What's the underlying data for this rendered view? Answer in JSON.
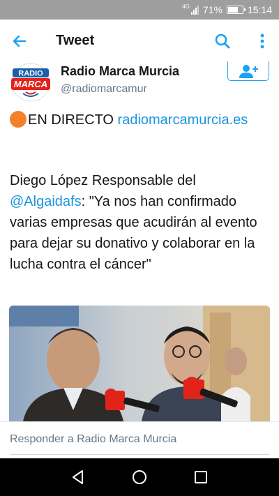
{
  "status_bar": {
    "network": "4G",
    "battery": "71%",
    "battery_level": 0.71,
    "time": "15:14"
  },
  "app_bar": {
    "title": "Tweet",
    "icons": [
      "back-arrow-icon",
      "search-icon",
      "more-vert-icon"
    ]
  },
  "tweet": {
    "author_name": "Radio Marca Murcia",
    "author_handle": "@radiomarcamur",
    "avatar_text": {
      "top": "RADIO",
      "bottom": "MARCA"
    },
    "live_prefix": "EN DIRECTO",
    "live_link": "radiomarcamurcia.es",
    "body_before_mention": "Diego López Responsable del",
    "mention": "@Algaidafs",
    "body_after_mention": ": \"Ya nos han confirmado varias empresas que acudirán al evento para dejar su donativo y colaborar en la lucha contra el cáncer\""
  },
  "reply": {
    "placeholder": "Responder a Radio Marca Murcia"
  },
  "colors": {
    "accent": "#1da1f2",
    "link": "#1b95e0",
    "live_dot": "#f4802c",
    "brand_red": "#e2231a",
    "brand_blue": "#1b5fa8"
  }
}
